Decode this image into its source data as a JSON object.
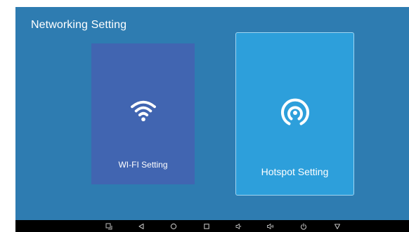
{
  "header": {
    "title": "Networking Setting"
  },
  "cards": [
    {
      "label": "WI-FI Setting",
      "icon": "wifi-icon"
    },
    {
      "label": "Hotspot Setting",
      "icon": "hotspot-icon"
    }
  ],
  "navbar": {
    "buttons": [
      "screenshot-icon",
      "back-icon",
      "home-icon",
      "recents-icon",
      "volume-down-icon",
      "volume-up-icon",
      "power-icon",
      "hide-navbar-icon"
    ]
  },
  "colors": {
    "background": "#2e7cb1",
    "wifi_card": "#4165b1",
    "hotspot_card": "#2d9fdb",
    "navbar": "#000000",
    "text": "#ffffff"
  }
}
